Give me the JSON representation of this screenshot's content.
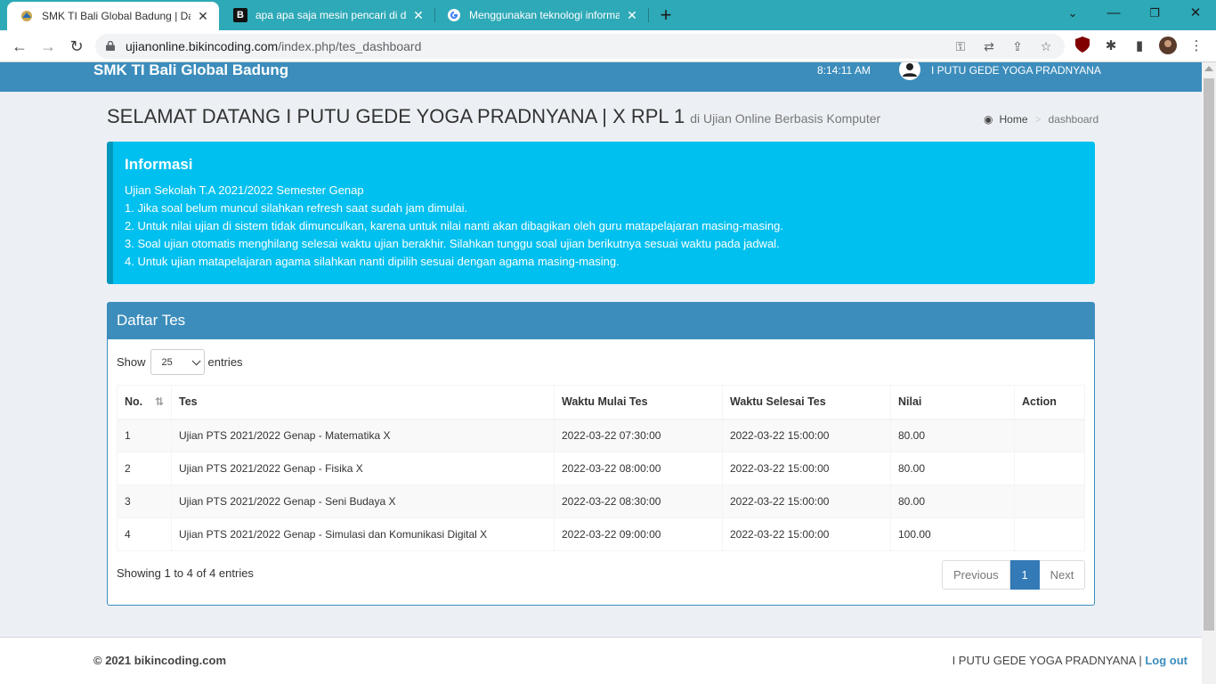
{
  "browser": {
    "tabs": [
      {
        "title": "SMK TI Bali Global Badung | Dashboard",
        "icon": "school-logo-icon",
        "active": true
      },
      {
        "title": "apa apa saja mesin pencari di dalam internet",
        "icon": "b-logo-icon",
        "active": false
      },
      {
        "title": "Menggunakan teknologi informasi",
        "icon": "google-icon",
        "active": false
      }
    ],
    "url_host": "ujianonline.bikincoding.com",
    "url_path": "/index.php/tes_dashboard"
  },
  "header": {
    "brand": "SMK TI Bali Global Badung",
    "clock": "8:14:11 AM",
    "user": "I PUTU GEDE YOGA PRADNYANA"
  },
  "content": {
    "title": "SELAMAT DATANG I PUTU GEDE YOGA PRADNYANA | X RPL 1",
    "subtitle": "di Ujian Online Berbasis Komputer",
    "breadcrumb": {
      "home": "Home",
      "separator": ">",
      "current": "dashboard"
    }
  },
  "callout": {
    "title": "Informasi",
    "lines": [
      "Ujian Sekolah T.A 2021/2022 Semester Genap",
      "1. Jika soal belum muncul silahkan refresh saat sudah jam dimulai.",
      "2. Untuk nilai ujian di sistem tidak dimunculkan, karena untuk nilai nanti akan dibagikan oleh guru matapelajaran masing-masing.",
      "3. Soal ujian otomatis menghilang selesai waktu ujian berakhir. Silahkan tunggu soal ujian berikutnya sesuai waktu pada jadwal.",
      "4. Untuk ujian matapelajaran agama silahkan nanti dipilih sesuai dengan agama masing-masing."
    ]
  },
  "box": {
    "title": "Daftar Tes",
    "show_label": "Show",
    "entries_value": "25",
    "entries_label": "entries",
    "columns": [
      "No.",
      "Tes",
      "Waktu Mulai Tes",
      "Waktu Selesai Tes",
      "Nilai",
      "Action"
    ],
    "rows": [
      [
        "1",
        "Ujian PTS 2021/2022 Genap - Matematika X",
        "2022-03-22 07:30:00",
        "2022-03-22 15:00:00",
        "80.00",
        ""
      ],
      [
        "2",
        "Ujian PTS 2021/2022 Genap - Fisika X",
        "2022-03-22 08:00:00",
        "2022-03-22 15:00:00",
        "80.00",
        ""
      ],
      [
        "3",
        "Ujian PTS 2021/2022 Genap - Seni Budaya X",
        "2022-03-22 08:30:00",
        "2022-03-22 15:00:00",
        "80.00",
        ""
      ],
      [
        "4",
        "Ujian PTS 2021/2022 Genap - Simulasi dan Komunikasi Digital X",
        "2022-03-22 09:00:00",
        "2022-03-22 15:00:00",
        "100.00",
        ""
      ]
    ],
    "info": "Showing 1 to 4 of 4 entries",
    "pagination": {
      "previous": "Previous",
      "current": "1",
      "next": "Next"
    }
  },
  "footer": {
    "copyright": "© 2021 bikincoding.com",
    "user": "I PUTU GEDE YOGA PRADNYANA",
    "separator": "|",
    "logout": "Log out"
  },
  "colors": {
    "header": "#3c8dbc",
    "callout": "#00c0ef",
    "tabbar": "#2ea9b7"
  }
}
